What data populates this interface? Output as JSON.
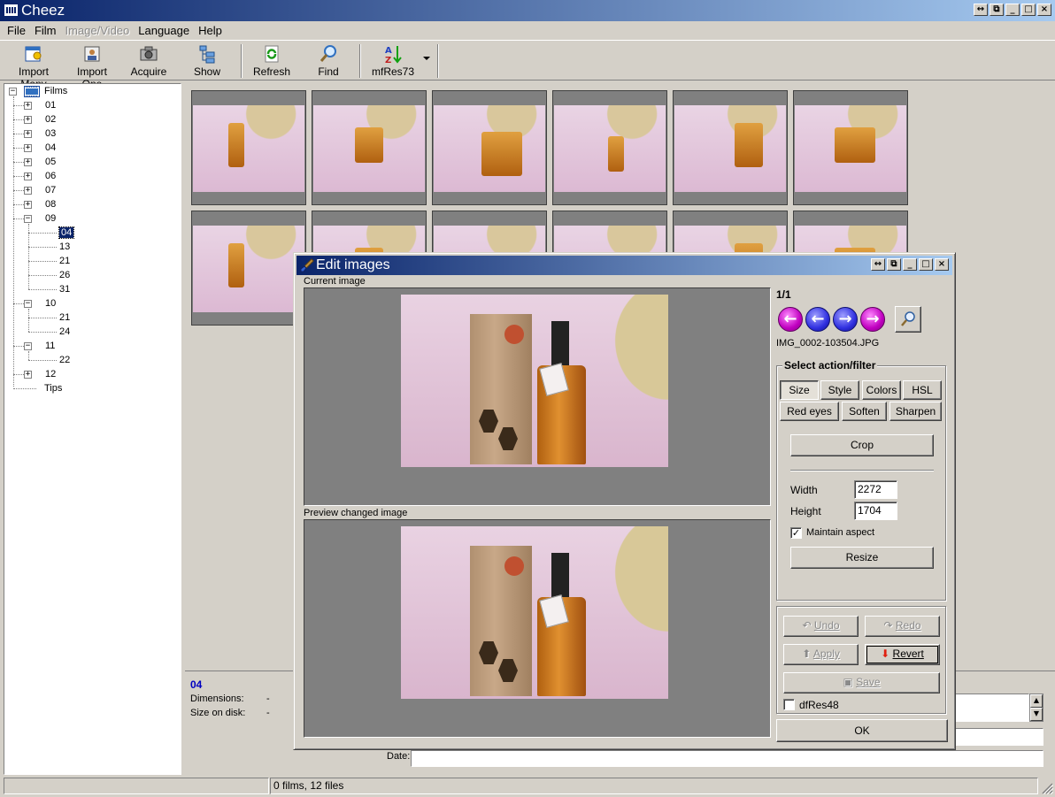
{
  "app": {
    "title": "Cheez"
  },
  "menu": [
    "File",
    "Film",
    "Image/Video",
    "Language",
    "Help"
  ],
  "toolbar": {
    "import_many": "Import Many",
    "import_one": "Import One",
    "acquire": "Acquire",
    "show": "Show",
    "refresh": "Refresh",
    "find": "Find",
    "sort": "mfRes73"
  },
  "tree": {
    "root": "Films",
    "films": [
      "01",
      "02",
      "03",
      "04",
      "05",
      "06",
      "07",
      "08",
      "09"
    ],
    "film09_children": [
      "04",
      "13",
      "21",
      "26",
      "31"
    ],
    "film10": "10",
    "film10_children": [
      "21",
      "24"
    ],
    "film11": "11",
    "film11_children": [
      "22"
    ],
    "film12": "12",
    "tips": "Tips"
  },
  "info": {
    "name": "04",
    "dimensions_label": "Dimensions:",
    "dimensions_value": "-",
    "size_label": "Size on disk:",
    "size_value": "-",
    "date_label": "Date:"
  },
  "status": {
    "right": "0 films, 12 files"
  },
  "dialog": {
    "title": "Edit images",
    "current_label": "Current image",
    "preview_label": "Preview changed image",
    "counter": "1/1",
    "filename": "IMG_0002-103504.JPG",
    "group_title": "Select action/filter",
    "tabs": [
      "Size",
      "Style",
      "Colors",
      "HSL",
      "Red eyes",
      "Soften",
      "Sharpen"
    ],
    "crop": "Crop",
    "width_label": "Width",
    "width_value": "2272",
    "height_label": "Height",
    "height_value": "1704",
    "maintain_aspect": "Maintain aspect",
    "resize": "Resize",
    "undo": "Undo",
    "redo": "Redo",
    "apply": "Apply",
    "revert": "Revert",
    "save": "Save",
    "dfres": "dfRes48",
    "ok": "OK"
  },
  "colors": {
    "title_from": "#0a246a",
    "title_to": "#a6caf0",
    "selection": "#0a246a",
    "info_name": "#0000c0"
  }
}
